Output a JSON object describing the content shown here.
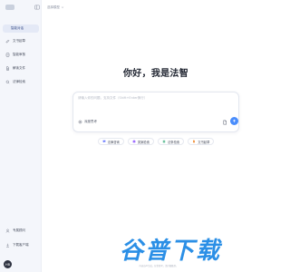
{
  "sidebar": {
    "new_chat_label": "智能对话",
    "items": [
      {
        "label": "文书起草",
        "icon": "edit-icon"
      },
      {
        "label": "智能审核",
        "icon": "audit-icon"
      },
      {
        "label": "解读文件",
        "icon": "file-read-icon"
      },
      {
        "label": "法律检索",
        "icon": "search-icon"
      }
    ],
    "bottom": [
      {
        "label": "专属顾问",
        "icon": "advisor-icon"
      },
      {
        "label": "下载客户端",
        "icon": "download-icon"
      }
    ],
    "avatar_text": "HB"
  },
  "header": {
    "model_label": "选择模型"
  },
  "main": {
    "greeting": "你好，我是法智",
    "input_placeholder": "请输入你的问题，支持文件（Shift+Enter换行）",
    "deep_think_label": "深度思考",
    "chips": [
      {
        "label": "法律咨询",
        "icon": "chat-icon",
        "color": "#6d7dff"
      },
      {
        "label": "类案检索",
        "icon": "case-icon",
        "color": "#a070ff"
      },
      {
        "label": "法条检索",
        "icon": "law-icon",
        "color": "#4fb58a"
      },
      {
        "label": "文书起草",
        "icon": "doc-icon",
        "color": "#f2994a"
      }
    ]
  },
  "footer": {
    "note": "内容由AI生成，仅供参考，请仔细甄别。"
  },
  "watermark": {
    "text": "谷普下载"
  },
  "colors": {
    "accent": "#4a8dfc",
    "sidebar_bg": "#f4f6fb",
    "watermark": "#2b8fe6"
  }
}
